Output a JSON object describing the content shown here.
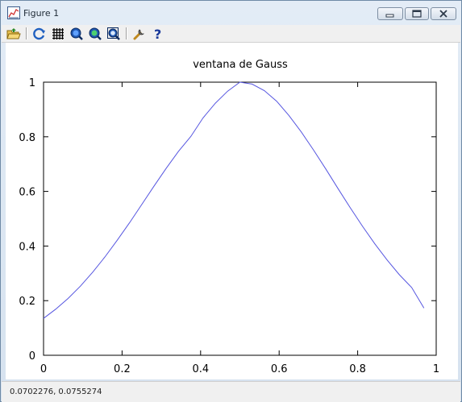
{
  "window": {
    "title": "Figure 1"
  },
  "toolbar": {
    "buttons": [
      {
        "name": "open-folder-icon",
        "tooltip": ""
      },
      {
        "name": "refresh-icon",
        "tooltip": ""
      },
      {
        "name": "grid-icon",
        "tooltip": ""
      },
      {
        "name": "zoom-in-icon",
        "tooltip": ""
      },
      {
        "name": "zoom-out-icon",
        "tooltip": ""
      },
      {
        "name": "zoom-fit-icon",
        "tooltip": ""
      },
      {
        "name": "wrench-icon",
        "tooltip": ""
      },
      {
        "name": "help-icon",
        "tooltip": ""
      }
    ]
  },
  "statusbar": {
    "coordinates": "0.0702276,  0.0755274"
  },
  "colors": {
    "series": "#5656e0",
    "axes": "#000000"
  },
  "chart_data": {
    "type": "line",
    "title": "ventana de Gauss",
    "xlabel": "",
    "ylabel": "",
    "xlim": [
      0,
      1
    ],
    "ylim": [
      0,
      1
    ],
    "xticks": [
      "0",
      "0.2",
      "0.4",
      "0.6",
      "0.8",
      "1"
    ],
    "yticks": [
      "0",
      "0.2",
      "0.4",
      "0.6",
      "0.8",
      "1"
    ],
    "grid": false,
    "series": [
      {
        "name": "",
        "x": [
          0,
          0.0312,
          0.0625,
          0.0938,
          0.125,
          0.1562,
          0.1875,
          0.2188,
          0.25,
          0.2812,
          0.3125,
          0.3438,
          0.375,
          0.4062,
          0.4375,
          0.4688,
          0.5,
          0.5312,
          0.5625,
          0.5938,
          0.625,
          0.6562,
          0.6875,
          0.7188,
          0.75,
          0.7812,
          0.8125,
          0.8438,
          0.875,
          0.9062,
          0.9375,
          0.9688
        ],
        "y": [
          0.135,
          0.169,
          0.208,
          0.253,
          0.304,
          0.36,
          0.421,
          0.485,
          0.552,
          0.619,
          0.685,
          0.747,
          0.801,
          0.869,
          0.923,
          0.967,
          1.0,
          0.993,
          0.969,
          0.93,
          0.878,
          0.818,
          0.752,
          0.682,
          0.61,
          0.54,
          0.472,
          0.408,
          0.349,
          0.295,
          0.248,
          0.173
        ]
      }
    ]
  }
}
